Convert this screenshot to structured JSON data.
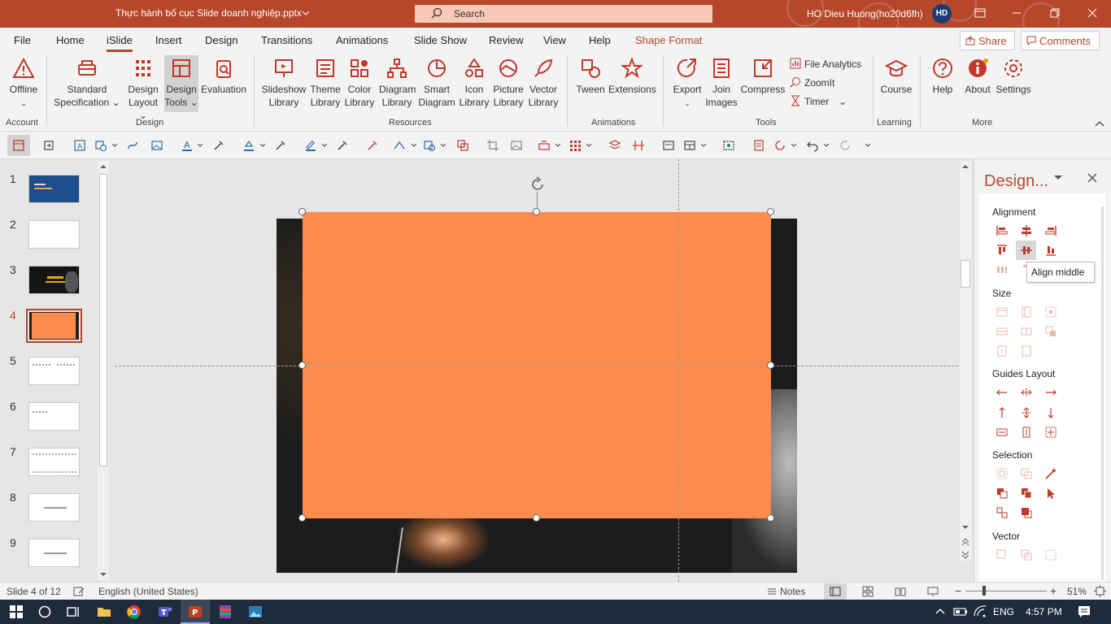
{
  "window": {
    "title": "Thực hành bố cục Slide doanh nghiệp.pptx",
    "search_placeholder": "Search",
    "user_name": "HO Dieu Huong(ho20d6fh)",
    "user_initials": "HD",
    "accent": "#b7472a"
  },
  "tabs": [
    {
      "label": "File"
    },
    {
      "label": "Home"
    },
    {
      "label": "iSlide"
    },
    {
      "label": "Insert"
    },
    {
      "label": "Design"
    },
    {
      "label": "Transitions"
    },
    {
      "label": "Animations"
    },
    {
      "label": "Slide Show"
    },
    {
      "label": "Review"
    },
    {
      "label": "View"
    },
    {
      "label": "Help"
    },
    {
      "label": "Shape Format"
    }
  ],
  "share_label": "Share",
  "comments_label": "Comments",
  "ribbon": {
    "offline": "Offline",
    "standard_spec": "Standard",
    "standard_spec2": "Specification",
    "design_layout": "Design",
    "design_layout2": "Layout",
    "design_tools": "Design",
    "design_tools2": "Tools",
    "evaluation": "Evaluation",
    "slideshow_lib": "Slideshow",
    "slideshow_lib2": "Library",
    "theme_lib": "Theme",
    "theme_lib2": "Library",
    "color_lib": "Color",
    "color_lib2": "Library",
    "diagram_lib": "Diagram",
    "diagram_lib2": "Library",
    "smart_diagram": "Smart",
    "smart_diagram2": "Diagram",
    "icon_lib": "Icon",
    "icon_lib2": "Library",
    "picture_lib": "Picture",
    "picture_lib2": "Library",
    "vector_lib": "Vector",
    "vector_lib2": "Library",
    "tween": "Tween",
    "extensions": "Extensions",
    "export": "Export",
    "join_images": "Join",
    "join_images2": "Images",
    "compress": "Compress",
    "file_analytics": "File Analytics",
    "zoomit": "ZoomIt",
    "timer": "Timer",
    "course": "Course",
    "help": "Help",
    "about": "About",
    "settings": "Settings",
    "groups": {
      "account": "Account",
      "design": "Design",
      "resources": "Resources",
      "animations": "Animations",
      "tools": "Tools",
      "learning": "Learning",
      "more": "More"
    }
  },
  "slides": {
    "numbers": [
      "1",
      "2",
      "3",
      "4",
      "5",
      "6",
      "7",
      "8",
      "9"
    ],
    "active": "4"
  },
  "pane": {
    "title": "Design...",
    "alignment": "Alignment",
    "size": "Size",
    "guides_layout": "Guides Layout",
    "selection": "Selection",
    "vector": "Vector",
    "tooltip": "Align middle"
  },
  "status": {
    "slide_info": "Slide 4 of 12",
    "language": "English (United States)",
    "notes": "Notes",
    "zoom": "51%"
  },
  "taskbar": {
    "lang": "ENG",
    "time": "4:57 PM"
  }
}
